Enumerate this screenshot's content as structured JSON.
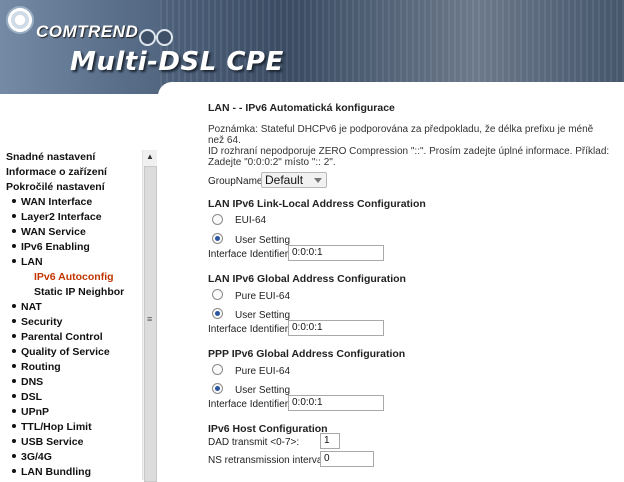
{
  "banner": {
    "brand": "COMTREND",
    "product": "Multi-DSL CPE"
  },
  "sidebar": {
    "items": [
      {
        "label": "Snadné nastavení",
        "level": 0,
        "bullet": false
      },
      {
        "label": "Informace o zařízení",
        "level": 0,
        "bullet": false
      },
      {
        "label": "Pokročilé nastavení",
        "level": 0,
        "bullet": false
      },
      {
        "label": "WAN Interface",
        "level": 1,
        "bullet": true
      },
      {
        "label": "Layer2 Interface",
        "level": 1,
        "bullet": true
      },
      {
        "label": "WAN Service",
        "level": 1,
        "bullet": true
      },
      {
        "label": "IPv6 Enabling",
        "level": 1,
        "bullet": true
      },
      {
        "label": "LAN",
        "level": 1,
        "bullet": true
      },
      {
        "label": "IPv6 Autoconfig",
        "level": 2,
        "bullet": false,
        "active": true
      },
      {
        "label": "Static IP Neighbor",
        "level": 2,
        "bullet": false
      },
      {
        "label": "NAT",
        "level": 1,
        "bullet": true
      },
      {
        "label": "Security",
        "level": 1,
        "bullet": true
      },
      {
        "label": "Parental Control",
        "level": 1,
        "bullet": true
      },
      {
        "label": "Quality of Service",
        "level": 1,
        "bullet": true
      },
      {
        "label": "Routing",
        "level": 1,
        "bullet": true
      },
      {
        "label": "DNS",
        "level": 1,
        "bullet": true
      },
      {
        "label": "DSL",
        "level": 1,
        "bullet": true
      },
      {
        "label": "UPnP",
        "level": 1,
        "bullet": true
      },
      {
        "label": "TTL/Hop Limit",
        "level": 1,
        "bullet": true
      },
      {
        "label": "USB Service",
        "level": 1,
        "bullet": true
      },
      {
        "label": "3G/4G",
        "level": 1,
        "bullet": true
      },
      {
        "label": "LAN Bundling",
        "level": 1,
        "bullet": true
      }
    ],
    "active_color": "#c03500"
  },
  "main": {
    "title": "LAN - - IPv6 Automatická konfigurace",
    "note_line1": "Poznámka: Stateful DHCPv6 je podporována za předpokladu, že délka prefixu je méně než 64.",
    "note_line2": "ID rozhraní nepodporuje ZERO Compression \"::\". Prosím zadejte úplné informace. Příklad:",
    "note_line3": "Zadejte \"0:0:0:2\" místo \":: 2\".",
    "group_label": "GroupName",
    "group_value": "Default",
    "link_local": {
      "title": "LAN IPv6 Link-Local Address Configuration",
      "option1": "EUI-64",
      "option2": "User Setting",
      "selected": "User Setting",
      "iface_label": "Interface Identifier:",
      "iface_value": "0:0:0:1"
    },
    "global": {
      "title": "LAN IPv6 Global Address Configuration",
      "option1": "Pure EUI-64",
      "option2": "User Setting",
      "selected": "User Setting",
      "iface_label": "Interface Identifier:",
      "iface_value": "0:0:0:1"
    },
    "ppp_global": {
      "title": "PPP IPv6 Global Address Configuration",
      "option1": "Pure EUI-64",
      "option2": "User Setting",
      "selected": "User Setting",
      "iface_label": "Interface Identifier:",
      "iface_value": "0:0:0:1"
    },
    "host": {
      "title": "IPv6 Host Configuration",
      "dad_label": "DAD transmit <0-7>:",
      "dad_value": "1",
      "ns_label": "NS retransmission interval:",
      "ns_value": "0"
    }
  }
}
